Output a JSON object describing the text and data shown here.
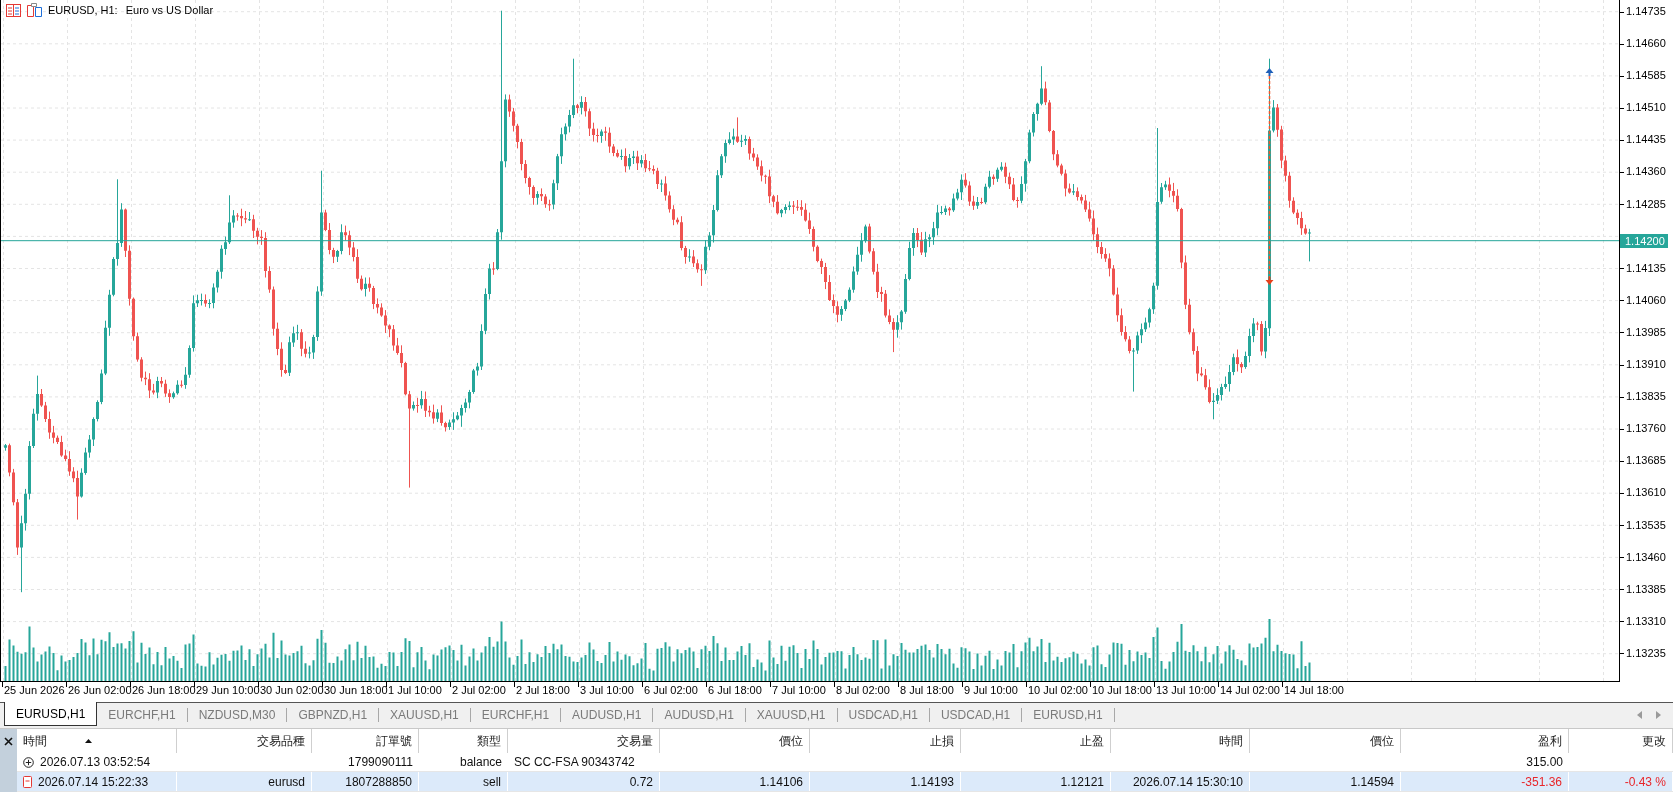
{
  "chart": {
    "title": {
      "symbol": "EURUSD, H1:",
      "description": "Euro vs US Dollar"
    },
    "price_axis": [
      {
        "kind": "tick",
        "label": "1.14735"
      },
      {
        "kind": "tick",
        "label": "1.14660"
      },
      {
        "kind": "tick",
        "label": "1.14585"
      },
      {
        "kind": "tick",
        "label": "1.14510"
      },
      {
        "kind": "tick",
        "label": "1.14435"
      },
      {
        "kind": "tick",
        "label": "1.14360"
      },
      {
        "kind": "tick",
        "label": "1.14285"
      },
      {
        "kind": "price_tag",
        "label": "1.14200"
      },
      {
        "kind": "tick",
        "label": "1.14135"
      },
      {
        "kind": "tick",
        "label": "1.14060"
      },
      {
        "kind": "tick",
        "label": "1.13985"
      },
      {
        "kind": "tick",
        "label": "1.13910"
      },
      {
        "kind": "tick",
        "label": "1.13835"
      },
      {
        "kind": "tick",
        "label": "1.13760"
      },
      {
        "kind": "tick",
        "label": "1.13685"
      },
      {
        "kind": "tick",
        "label": "1.13610"
      },
      {
        "kind": "tick",
        "label": "1.13535"
      },
      {
        "kind": "tick",
        "label": "1.13460"
      },
      {
        "kind": "tick",
        "label": "1.13385"
      },
      {
        "kind": "tick",
        "label": "1.13310"
      },
      {
        "kind": "tick",
        "label": "1.13235"
      }
    ],
    "time_axis": [
      "25 Jun 2026",
      "26 Jun 02:00",
      "26 Jun 18:00",
      "29 Jun 10:00",
      "30 Jun 02:00",
      "30 Jun 18:00",
      "1 Jul 10:00",
      "2 Jul 02:00",
      "2 Jul 18:00",
      "3 Jul 10:00",
      "6 Jul 02:00",
      "6 Jul 18:00",
      "7 Jul 10:00",
      "8 Jul 02:00",
      "8 Jul 18:00",
      "9 Jul 10:00",
      "10 Jul 02:00",
      "10 Jul 18:00",
      "13 Jul 10:00",
      "14 Jul 02:00",
      "14 Jul 18:00"
    ]
  },
  "tabs": [
    {
      "label": "EURUSD,H1",
      "selected": true
    },
    {
      "label": "EURCHF,H1",
      "selected": false
    },
    {
      "label": "NZDUSD,M30",
      "selected": false
    },
    {
      "label": "GBPNZD,H1",
      "selected": false
    },
    {
      "label": "XAUUSD,H1",
      "selected": false
    },
    {
      "label": "EURCHF,H1",
      "selected": false
    },
    {
      "label": "AUDUSD,H1",
      "selected": false
    },
    {
      "label": "AUDUSD,H1",
      "selected": false
    },
    {
      "label": "XAUUSD,H1",
      "selected": false
    },
    {
      "label": "USDCAD,H1",
      "selected": false
    },
    {
      "label": "USDCAD,H1",
      "selected": false
    },
    {
      "label": "EURUSD,H1",
      "selected": false
    }
  ],
  "table": {
    "columns": [
      {
        "label": "時間",
        "sorted": true
      },
      {
        "label": "交易品種",
        "sorted": false
      },
      {
        "label": "訂單號",
        "sorted": false
      },
      {
        "label": "類型",
        "sorted": false
      },
      {
        "label": "交易量",
        "sorted": false
      },
      {
        "label": "價位",
        "sorted": false
      },
      {
        "label": "止損",
        "sorted": false
      },
      {
        "label": "止盈",
        "sorted": false
      },
      {
        "label": "時間",
        "sorted": false
      },
      {
        "label": "價位",
        "sorted": false
      },
      {
        "label": "盈利",
        "sorted": false
      },
      {
        "label": "更改",
        "sorted": false
      }
    ],
    "rows": [
      {
        "kind": "balance",
        "selected": false,
        "loss": false,
        "time": "2026.07.13 03:52:54",
        "order": "1799090111",
        "type": "balance",
        "comment": "SC CC-FSA 90343742",
        "profit": "315.00"
      },
      {
        "kind": "position",
        "selected": true,
        "loss": true,
        "time": "2026.07.14 15:22:33",
        "symbol": "eurusd",
        "order": "1807288850",
        "type": "sell",
        "volume": "0.72",
        "price": "1.14106",
        "sl": "1.14193",
        "tp": "1.12121",
        "close_time": "2026.07.14 15:30:10",
        "close_price": "1.14594",
        "profit": "-351.36",
        "change": "-0.43 %"
      }
    ]
  }
}
